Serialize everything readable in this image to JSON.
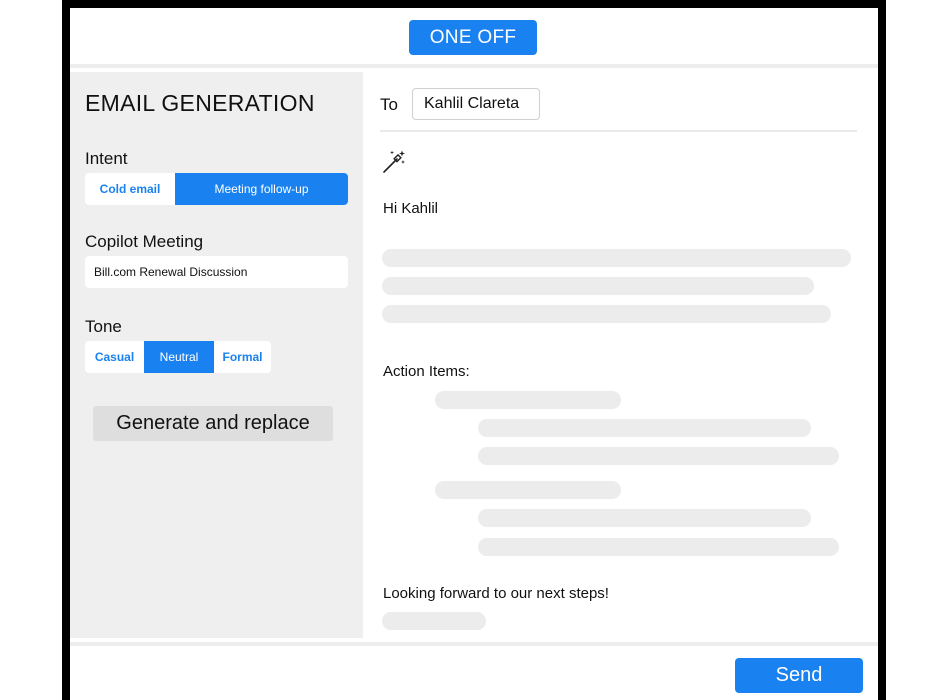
{
  "header": {
    "mode_label": "ONE OFF"
  },
  "left_panel": {
    "title": "EMAIL GENERATION",
    "intent": {
      "label": "Intent",
      "options": [
        "Cold email",
        "Meeting follow-up"
      ],
      "selected": "Meeting follow-up"
    },
    "meeting": {
      "label": "Copilot Meeting",
      "value": "Bill.com Renewal Discussion"
    },
    "tone": {
      "label": "Tone",
      "options": [
        "Casual",
        "Neutral",
        "Formal"
      ],
      "selected": "Neutral"
    },
    "generate_label": "Generate and replace"
  },
  "email": {
    "to_label": "To",
    "to_value": "Kahlil Clareta",
    "greeting": "Hi Kahlil",
    "action_items_label": "Action Items:",
    "closing": "Looking forward to our next steps!",
    "icons": {
      "generate": "magic-wand-icon"
    }
  },
  "footer": {
    "send_label": "Send"
  },
  "colors": {
    "accent": "#1a82f0",
    "panel_background": "#efefef",
    "placeholder": "#ececec"
  }
}
